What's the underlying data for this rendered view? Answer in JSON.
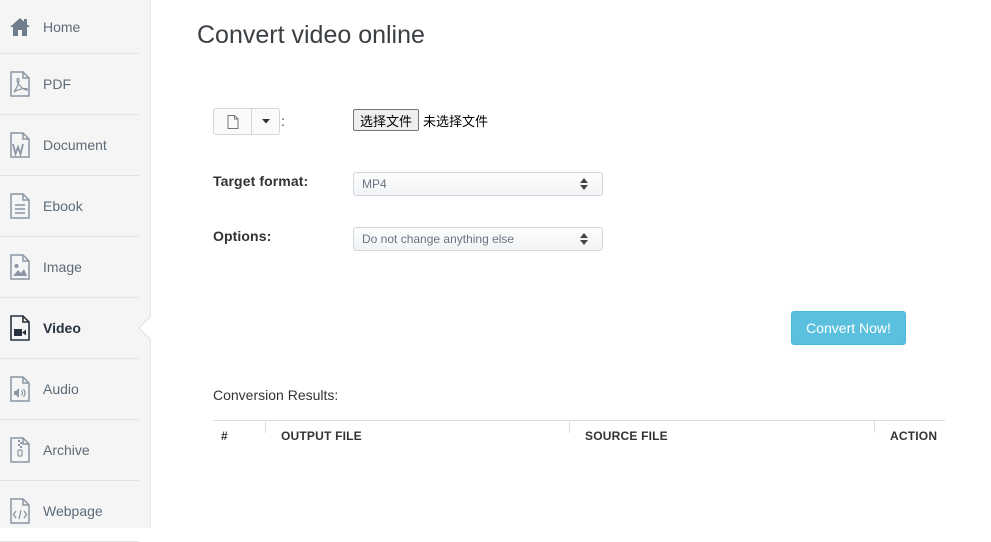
{
  "sidebar": {
    "items": [
      {
        "label": "Home",
        "icon": "home-icon",
        "active": false
      },
      {
        "label": "PDF",
        "icon": "pdf-file-icon",
        "active": false
      },
      {
        "label": "Document",
        "icon": "word-document-icon",
        "active": false
      },
      {
        "label": "Ebook",
        "icon": "ebook-file-icon",
        "active": false
      },
      {
        "label": "Image",
        "icon": "image-file-icon",
        "active": false
      },
      {
        "label": "Video",
        "icon": "video-file-icon",
        "active": true
      },
      {
        "label": "Audio",
        "icon": "audio-file-icon",
        "active": false
      },
      {
        "label": "Archive",
        "icon": "archive-file-icon",
        "active": false
      },
      {
        "label": "Webpage",
        "icon": "code-file-icon",
        "active": false
      }
    ]
  },
  "main": {
    "title": "Convert video online",
    "source": {
      "colon": ":",
      "file_button_label": "选择文件",
      "file_status": "未选择文件"
    },
    "target_format": {
      "label": "Target format:",
      "value": "MP4"
    },
    "options": {
      "label": "Options:",
      "value": "Do not change anything else"
    },
    "convert_button": "Convert Now!",
    "results": {
      "title": "Conversion Results:",
      "columns": [
        "#",
        "OUTPUT FILE",
        "SOURCE FILE",
        "ACTION"
      ]
    }
  },
  "colors": {
    "accent": "#5bc0de",
    "sidebar_bg": "#f5f5f5",
    "sidebar_text": "#5d6b78",
    "active_text": "#27323e"
  }
}
